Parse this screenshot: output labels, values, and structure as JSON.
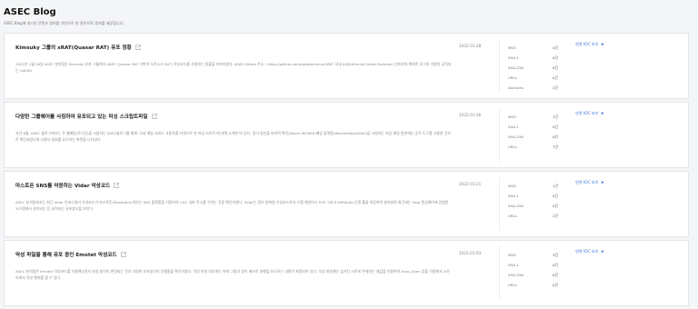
{
  "header": {
    "title": "ASEC Blog",
    "subtitle": "ASEC Blog에 게시된 콘텐츠 정보를 기반으로 한 연관 IOC 정보를 제공합니다."
  },
  "ioc_link_label": "연관 IOC 보기",
  "posts": [
    {
      "title": "Kimsuky 그룹의 xRAT(Quasar RAT) 유포 정황",
      "date": "2022-01-28",
      "description": "2022년 1월 26일 ASEC 분석팀은 Kimsuky 유포 그룹에서 xRAT (Quasar RAT 기반의 오픈소스 RAT) 악성코드를 사용하는 정황을 포착하였다. xRAT Github 주소 : https://github.com/qwqdanchun/xRAT 국내 ASD(AhnLab Smart Defense) 인프라의 확보된 로그와 악용된 공격자는 GoldDr",
      "stats": [
        {
          "label": "MD5",
          "count": "4건"
        },
        {
          "label": "SHA-1",
          "count": "0건"
        },
        {
          "label": "SHA-256",
          "count": "0건"
        },
        {
          "label": "URLs",
          "count": "0건"
        },
        {
          "label": "Domains",
          "count": "2건"
        }
      ]
    },
    {
      "title": "다양한 그룹웨어를 사칭하여 유포되고 있는 피싱 스크립트파일",
      "date": "2022-01-26",
      "description": "과년 6월, ASEC 블로그에서는 각 웹메일(로그인)을 사칭하는 ASEC블로그를 통해 '국내 메일 서비스 사용자를 타겟으로 한 피싱 사이트'에 대해 소개한 바 있다. 동이 원인을 바라며 확인(Naver WORKS)메일 플랫폼(WorksMobile/Mail)을 사칭하는 피싱 메일 원본에는 공격 도구를 사용한 것으로 확인되었으며 사용자 정보를 요구하는 화면을 나타낸다.",
      "stats": [
        {
          "label": "MD5",
          "count": "1건"
        },
        {
          "label": "SHA-1",
          "count": "0건"
        },
        {
          "label": "SHA-256",
          "count": "0건"
        },
        {
          "label": "URLs",
          "count": "7건"
        }
      ]
    },
    {
      "title": "마스토돈 SNS를 악용하는 Vidar 악성코드",
      "date": "2022-01-21",
      "description": "ASEC 분석팀에서는 최근 Vidar 인포스틸러 악성코드가 마스토돈(Mastodon)이라는 SNS 플랫폼을 이용하여 C&C 서버 주소를 구하는 것을 확인하였다. Vidar는 정보 탈취형 악성코드로서 스팸 메일이나 PUP 그리고 KMSAuto 인증 툴을 위장하여 설치되며 최근에는 Stop 랜섬웨어에 감염된 시스템에서 설치되는 등 설치되는 유포방식을 보인다.",
      "stats": [
        {
          "label": "MD5",
          "count": "1건"
        },
        {
          "label": "SHA-1",
          "count": "0건"
        },
        {
          "label": "SHA-256",
          "count": "0건"
        },
        {
          "label": "URLs",
          "count": "2건"
        }
      ]
    },
    {
      "title": "악성 파일을 통해 유포 중인 Emotet 악성코드",
      "date": "2022-01-03",
      "description": "ASEC 분석팀은 Emotet 악성코드를 이용해오면서 파일 형식이 변경되는 것과 다양한 유포방식이 진행중을 확인하였다. 악성 파일 내부에는 아래 그림과 같이 매크로 실행을 유도하는 내용이 포함되어 있다. 악성 파일에는 숨겨진 시트에 존재하는 셀값을 이용하여 Auto_Open 등을 이용해서 시트 속에서 악성 행위를 할 수 있다.",
      "stats": [
        {
          "label": "MD5",
          "count": "3건"
        },
        {
          "label": "SHA-1",
          "count": "0건"
        },
        {
          "label": "SHA-256",
          "count": "0건"
        },
        {
          "label": "URLs",
          "count": "0건"
        }
      ]
    }
  ]
}
